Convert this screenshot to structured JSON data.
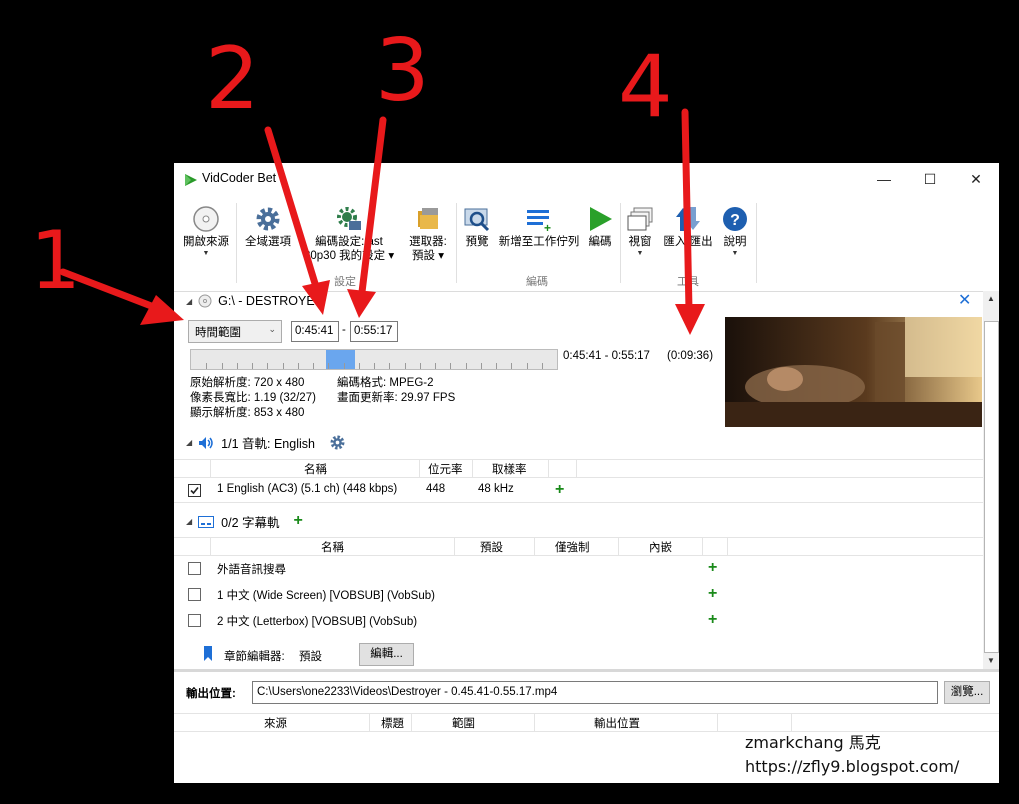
{
  "window": {
    "title": "VidCoder Bet",
    "controls": {
      "minimize": "—",
      "maximize": "☐",
      "close": "✕"
    }
  },
  "toolbar": {
    "open_source": "開啟來源",
    "global_options": "全域選項",
    "encode_settings_line1": "編碼設定: ast",
    "encode_settings_line2": "20p30 我的設定",
    "picker_line1": "選取器:",
    "picker_line2": "預設",
    "group_settings": "設定",
    "preview": "預覽",
    "add_to_queue": "新增至工作佇列",
    "encode": "編碼",
    "group_encode": "編碼",
    "window": "視窗",
    "import_export": "匯入/匯出",
    "help": "說明",
    "group_tools": "工具"
  },
  "source": {
    "name": "G:\\ - DESTROYER",
    "range_type": "時間範圍",
    "start_time": "0:45:41",
    "end_time": "0:55:17",
    "range_label": "0:45:41 - 0:55:17",
    "duration": "(0:09:36)",
    "range_fraction_start": 0.37,
    "range_fraction_end": 0.45
  },
  "video_info": {
    "orig_res_label": "原始解析度:",
    "orig_res": "720 x 480",
    "par_label": "像素長寬比:",
    "par": "1.19 (32/27)",
    "display_res_label": "顯示解析度:",
    "display_res": "853 x 480",
    "format_label": "編碼格式:",
    "format": "MPEG-2",
    "fps_label": "畫面更新率:",
    "fps": "29.97 FPS"
  },
  "audio": {
    "header": "1/1 音軌: English",
    "columns": [
      "名稱",
      "位元率",
      "取樣率"
    ],
    "rows": [
      {
        "name": "1 English (AC3) (5.1 ch) (448 kbps)",
        "bitrate": "448",
        "samplerate": "48 kHz",
        "checked": true
      }
    ]
  },
  "subtitles": {
    "header": "0/2 字幕軌",
    "columns": [
      "名稱",
      "預設",
      "僅強制",
      "內嵌"
    ],
    "rows": [
      {
        "name": "外語音訊搜尋"
      },
      {
        "name": "1 中文 (Wide Screen) [VOBSUB] (VobSub)"
      },
      {
        "name": "2 中文 (Letterbox) [VOBSUB] (VobSub)"
      }
    ]
  },
  "chapters": {
    "label": "章節編輯器:",
    "value": "預設",
    "edit_button": "編輯..."
  },
  "output": {
    "label": "輸出位置:",
    "path": "C:\\Users\\one2233\\Videos\\Destroyer - 0.45.41-0.55.17.mp4",
    "browse_button": "瀏覽..."
  },
  "queue": {
    "columns": [
      "來源",
      "標題",
      "範圍",
      "輸出位置"
    ]
  },
  "watermark": {
    "line1": "zmarkchang 馬克",
    "line2": "https://zfly9.blogspot.com/"
  },
  "annotations": [
    "1",
    "2",
    "3",
    "4"
  ],
  "colors": {
    "arrow_red": "#e8191b",
    "accent_blue": "#1e6fd6",
    "range_fill": "#6aa6ee",
    "plus_green": "#1a8a1a"
  }
}
